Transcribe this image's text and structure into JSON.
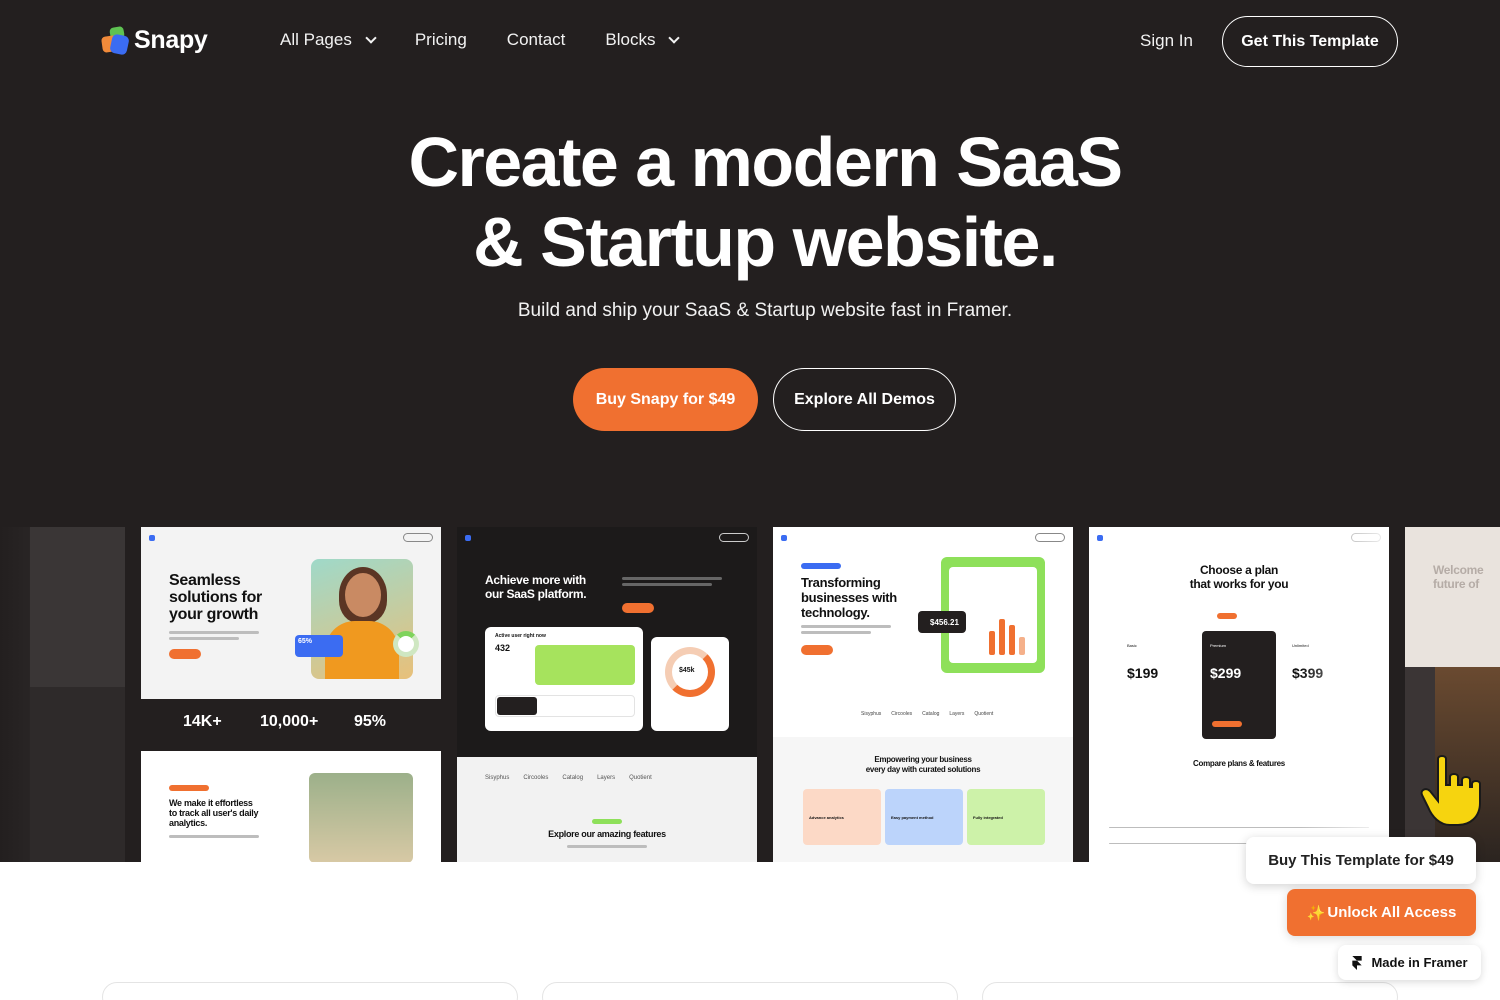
{
  "brand": {
    "name": "Snapy"
  },
  "nav": {
    "links": [
      {
        "label": "All Pages",
        "dropdown": true
      },
      {
        "label": "Pricing",
        "dropdown": false
      },
      {
        "label": "Contact",
        "dropdown": false
      },
      {
        "label": "Blocks",
        "dropdown": true
      }
    ],
    "sign_in": "Sign In",
    "cta": "Get This Template"
  },
  "hero": {
    "title_line1": "Create a modern SaaS",
    "title_line2": "& Startup website.",
    "subtitle": "Build and ship your SaaS & Startup website fast in Framer.",
    "primary_button": "Buy Snapy for $49",
    "secondary_button": "Explore All Demos"
  },
  "showcase": {
    "card1": {
      "headline_1": "Seamless",
      "headline_2": "solutions for",
      "headline_3": "your growth",
      "badge_value": "65%",
      "stats": [
        "14K+",
        "10,000+",
        "95%"
      ],
      "sub_headline_1": "We make it effortless",
      "sub_headline_2": "to track all user's daily",
      "sub_headline_3": "analytics."
    },
    "card2": {
      "headline_1": "Achieve more with",
      "headline_2": "our SaaS platform.",
      "panel_title": "Active user right now",
      "panel_value": "432",
      "dial_value": "$45k",
      "logos": [
        "Sisyphus",
        "Circooles",
        "Catalog",
        "Layers",
        "Quotient"
      ],
      "features_title": "Explore our amazing features"
    },
    "card3": {
      "headline_1": "Transforming",
      "headline_2": "businesses with",
      "headline_3": "technology.",
      "price_tag": "$456.21",
      "logos": [
        "Sisyphus",
        "Circooles",
        "Catalog",
        "Layers",
        "Quotient"
      ],
      "section_title_1": "Empowering your business",
      "section_title_2": "every day with curated solutions",
      "features": [
        "Advance analytics",
        "Easy payment method",
        "Fully integrated"
      ]
    },
    "card4": {
      "headline_1": "Choose a plan",
      "headline_2": "that works for you",
      "plans": [
        "Basic",
        "Premium",
        "Unlimited"
      ],
      "prices": [
        "$199",
        "$299",
        "$399"
      ],
      "compare_title": "Compare plans & features"
    },
    "card5": {
      "headline_1": "Welcome",
      "headline_2": "future of"
    }
  },
  "floating": {
    "buy": "Buy This Template for $49",
    "unlock": "Unlock All Access",
    "made_in": "Made in Framer"
  },
  "colors": {
    "hero_bg": "#231f1f",
    "accent": "#f07030",
    "text_light": "#ffffff"
  }
}
